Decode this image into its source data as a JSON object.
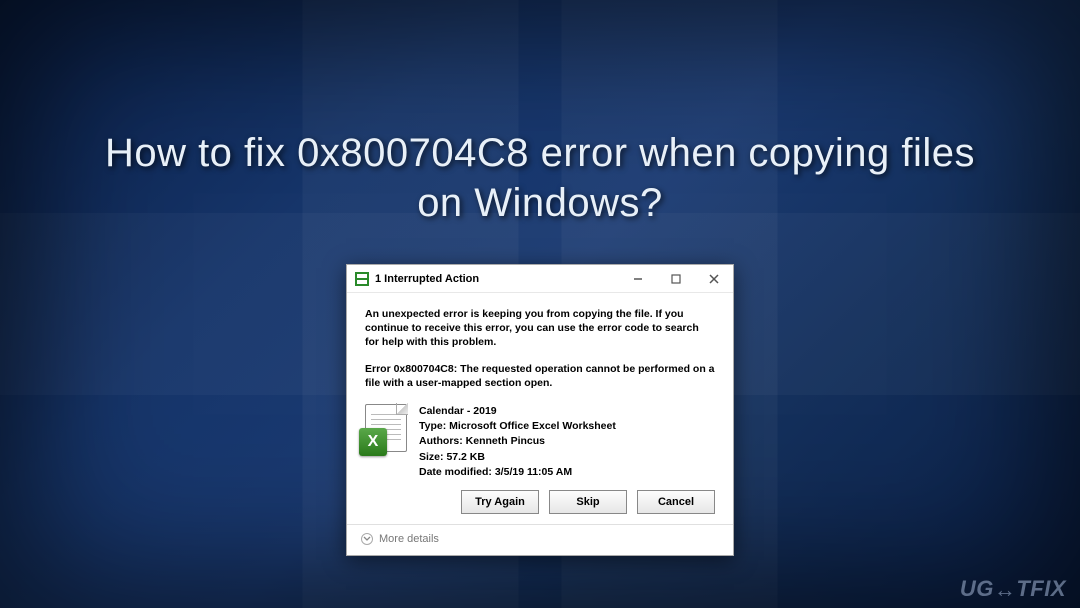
{
  "headline": "How to fix 0x800704C8 error when copying files on Windows?",
  "dialog": {
    "title": "1 Interrupted Action",
    "message1": "An unexpected error is keeping you from copying the file. If you continue to receive this error, you can use the error code to search for help with this problem.",
    "message2": "Error 0x800704C8: The requested operation cannot be performed on a file with a user-mapped section open.",
    "file": {
      "name": "Calendar - 2019",
      "type_label": "Type:",
      "type_value": "Microsoft Office Excel Worksheet",
      "authors_label": "Authors:",
      "authors_value": "Kenneth Pincus",
      "size_label": "Size:",
      "size_value": "57.2 KB",
      "modified_label": "Date modified:",
      "modified_value": "3/5/19 11:05 AM"
    },
    "buttons": {
      "try_again": "Try Again",
      "skip": "Skip",
      "cancel": "Cancel"
    },
    "more_details": "More details"
  },
  "watermark": "UG",
  "watermark2": "TFIX"
}
